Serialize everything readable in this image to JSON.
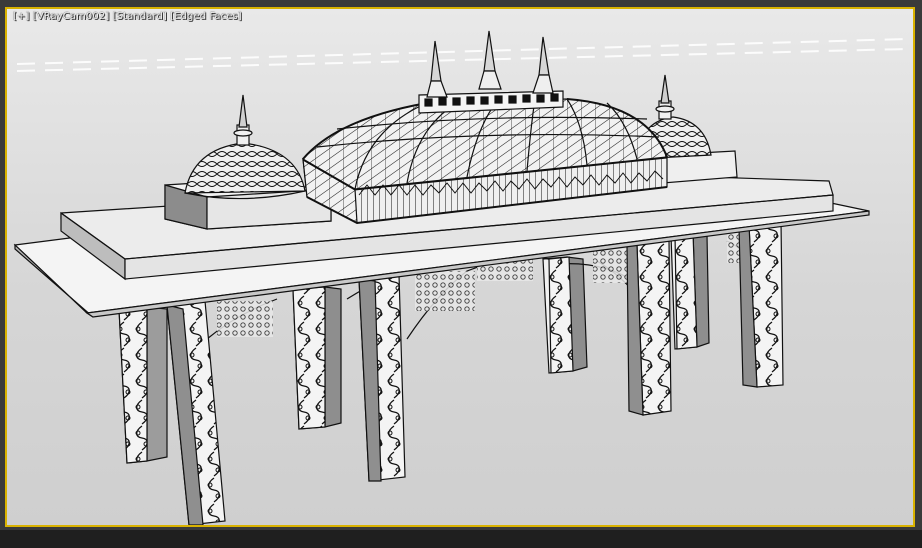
{
  "viewport": {
    "label_plus": "[+]",
    "label_camera": "[VRayCam002]",
    "label_shading": "[Standard]",
    "label_edges": "[Edged Faces]"
  },
  "colors": {
    "accent_border": "#d9b200",
    "viewport_bg": "#dedede",
    "model_face": "#f4f4f4",
    "model_shadow": "#9a9a9a",
    "wire": "#111111"
  }
}
